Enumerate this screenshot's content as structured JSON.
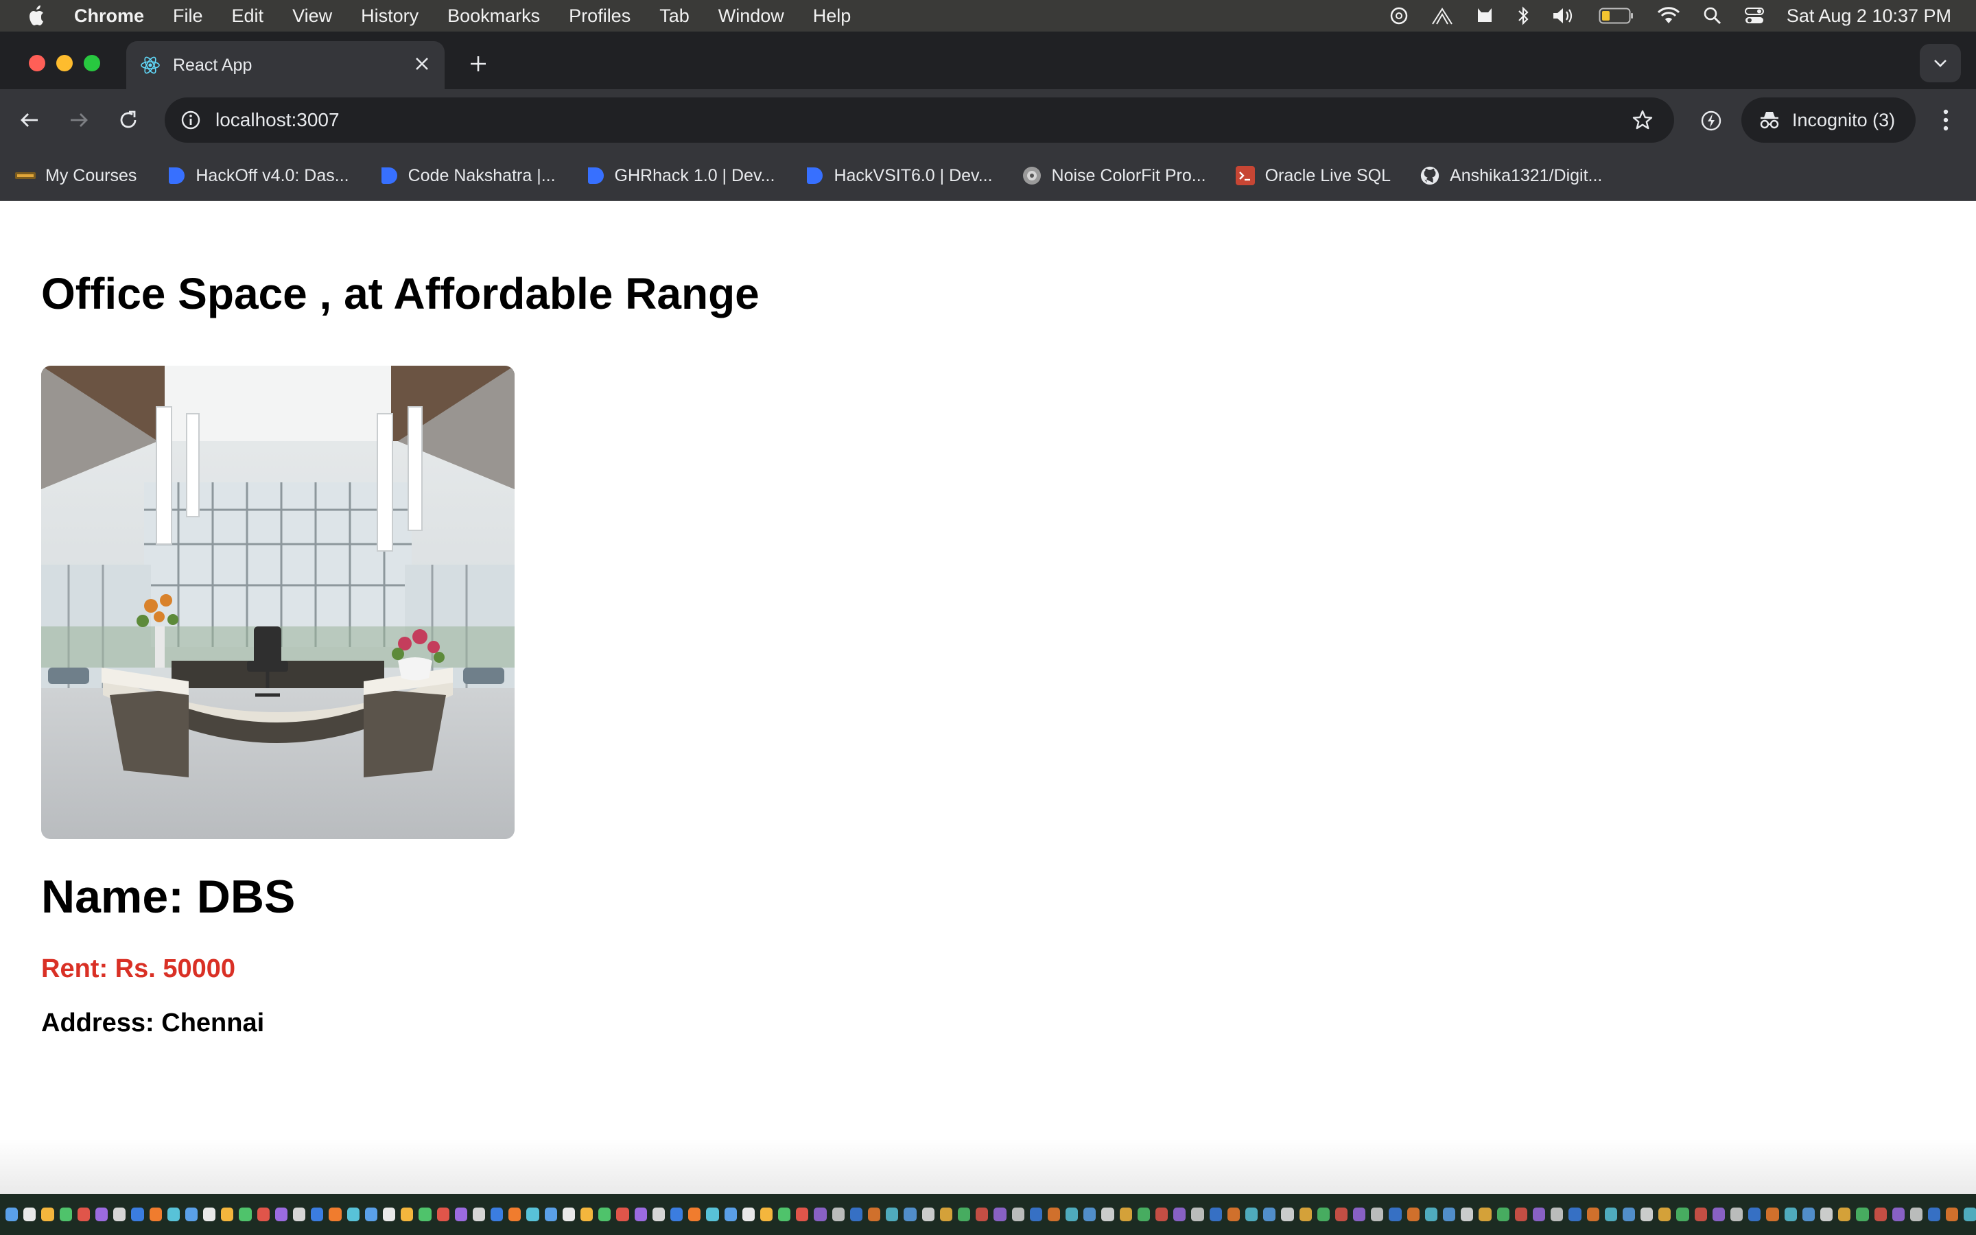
{
  "menubar": {
    "app_name": "Chrome",
    "items": [
      "File",
      "Edit",
      "View",
      "History",
      "Bookmarks",
      "Profiles",
      "Tab",
      "Window",
      "Help"
    ],
    "clock": "Sat Aug 2  10:37 PM"
  },
  "browser": {
    "tab": {
      "title": "React App",
      "favicon": "react-icon"
    },
    "url": "localhost:3007",
    "incognito_label": "Incognito (3)"
  },
  "bookmarks": [
    {
      "label": "My Courses",
      "icon": "course-icon"
    },
    {
      "label": "HackOff v4.0: Das...",
      "icon": "devfolio-icon"
    },
    {
      "label": "Code Nakshatra |...",
      "icon": "devfolio-icon"
    },
    {
      "label": "GHRhack 1.0 | Dev...",
      "icon": "devfolio-icon"
    },
    {
      "label": "HackVSIT6.0 | Dev...",
      "icon": "devfolio-icon"
    },
    {
      "label": "Noise ColorFit Pro...",
      "icon": "noise-icon"
    },
    {
      "label": "Oracle Live SQL",
      "icon": "oracle-icon"
    },
    {
      "label": "Anshika1321/Digit...",
      "icon": "github-icon"
    }
  ],
  "page": {
    "heading": "Office Space , at Affordable Range",
    "office": {
      "name": "Name: DBS",
      "rent": "Rent: Rs. 50000",
      "address": "Address: Chennai"
    }
  },
  "colors": {
    "rent_text": "#d93025",
    "react_blue": "#61dafb",
    "devfolio_blue": "#3770ff"
  }
}
